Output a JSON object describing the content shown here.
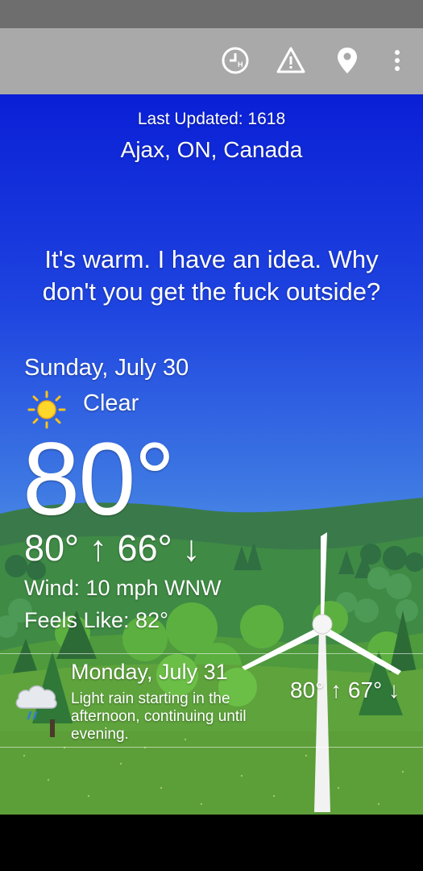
{
  "toolbar": {
    "icons": [
      "history-clock-icon",
      "alert-triangle-icon",
      "location-pin-icon",
      "overflow-menu-icon"
    ]
  },
  "header": {
    "last_updated": "Last Updated: 1618",
    "location": "Ajax, ON, Canada"
  },
  "quote": "It's warm. I have an idea. Why don't you get the fuck outside?",
  "today": {
    "date": "Sunday, July 30",
    "condition": "Clear",
    "condition_icon": "sun-icon",
    "temperature": "80°",
    "hi_lo": "80° ↑ 66° ↓",
    "wind": "Wind: 10 mph WNW",
    "feels_like": "Feels Like: 82°"
  },
  "forecast": [
    {
      "date": "Monday, July 31",
      "description": "Light rain starting in the afternoon, continuing until evening.",
      "icon": "rain-cloud-icon",
      "hi_lo": "80° ↑ 67° ↓"
    }
  ]
}
